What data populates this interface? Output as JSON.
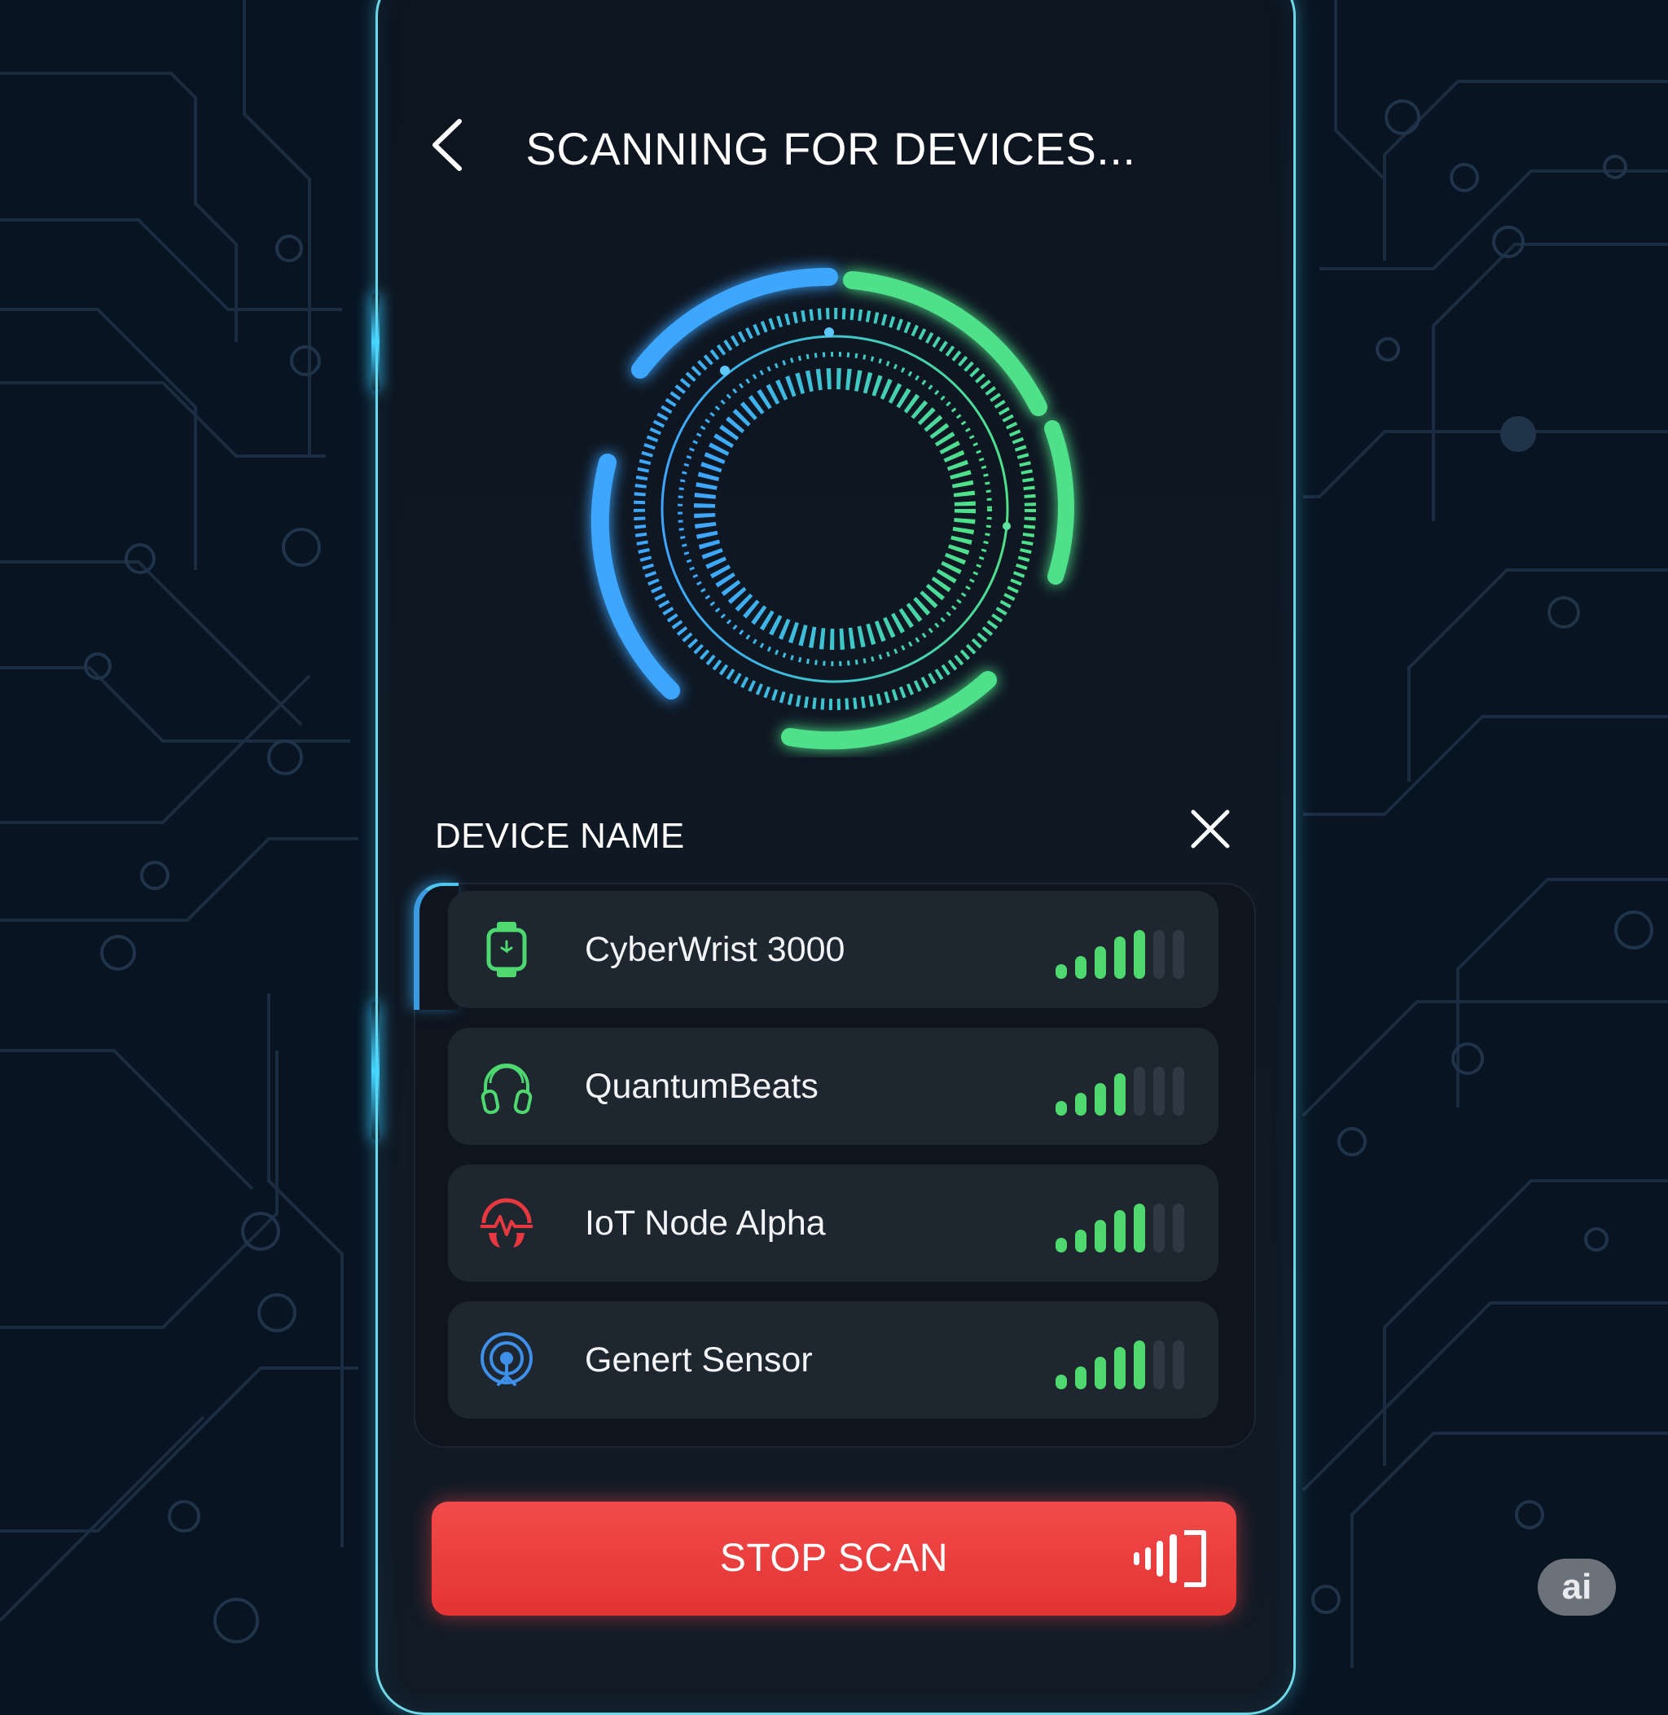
{
  "header": {
    "title": "SCANNING FOR DEVICES...",
    "back_icon": "chevron-left-icon"
  },
  "scanner": {
    "icon": "radar-ring-icon",
    "colors": {
      "blue": "#3ea6ff",
      "green": "#4fe08a"
    }
  },
  "list": {
    "heading": "DEVICE NAME",
    "close_icon": "close-icon",
    "devices": [
      {
        "name": "CyberWrist 3000",
        "icon": "smartwatch-icon",
        "icon_color": "#4fd870",
        "signal_bars_lit": 5,
        "signal_bars_total": 7,
        "selected": true
      },
      {
        "name": "QuantumBeats",
        "icon": "headphones-icon",
        "icon_color": "#4fd870",
        "signal_bars_lit": 4,
        "signal_bars_total": 7,
        "selected": false
      },
      {
        "name": "IoT Node Alpha",
        "icon": "heart-pulse-icon",
        "icon_color": "#e8383f",
        "signal_bars_lit": 5,
        "signal_bars_total": 7,
        "selected": false
      },
      {
        "name": "Genert Sensor",
        "icon": "sensor-icon",
        "icon_color": "#3e8fe8",
        "signal_bars_lit": 5,
        "signal_bars_total": 7,
        "selected": false
      }
    ]
  },
  "action": {
    "stop_label": "STOP SCAN",
    "stop_icon": "scan-signal-icon",
    "color": "#ef3b3b"
  },
  "badge": {
    "label": "ai"
  },
  "theme": {
    "accent": "#6fd8e6",
    "signal_on": "#4fd870",
    "signal_off": "#2e3944"
  }
}
